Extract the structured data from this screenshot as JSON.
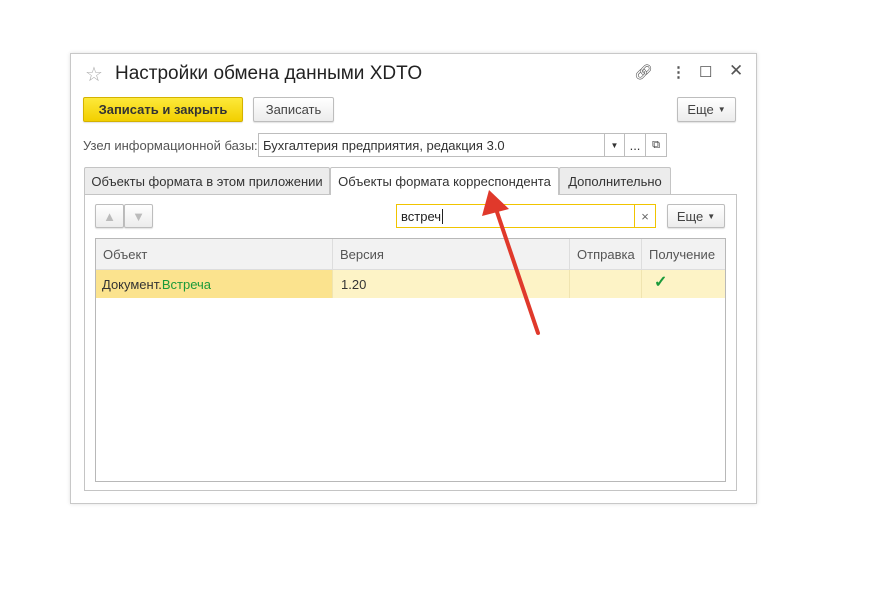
{
  "window": {
    "title": "Настройки обмена данными XDTO"
  },
  "toolbar": {
    "save_close": "Записать и закрыть",
    "save": "Записать",
    "more": "Еще"
  },
  "node": {
    "label": "Узел информационной базы:",
    "value": "Бухгалтерия предприятия, редакция 3.0",
    "ellipsis": "..."
  },
  "tabs": [
    {
      "label": "Объекты формата в этом приложении"
    },
    {
      "label": "Объекты формата корреспондента"
    },
    {
      "label": "Дополнительно"
    }
  ],
  "search": {
    "value": "встреч",
    "clear": "×"
  },
  "table_more": "Еще",
  "table": {
    "columns": [
      "Объект",
      "Версия",
      "Отправка",
      "Получение"
    ],
    "rows": [
      {
        "object_prefix": "Документ.",
        "object_match": "Встреча",
        "version": "1.20",
        "send": "",
        "receive": "✓"
      }
    ]
  },
  "colors": {
    "accent": "#f2cf00",
    "highlight": "#fdf3c6",
    "match": "#1a9a3a",
    "arrow": "#e0392b"
  }
}
